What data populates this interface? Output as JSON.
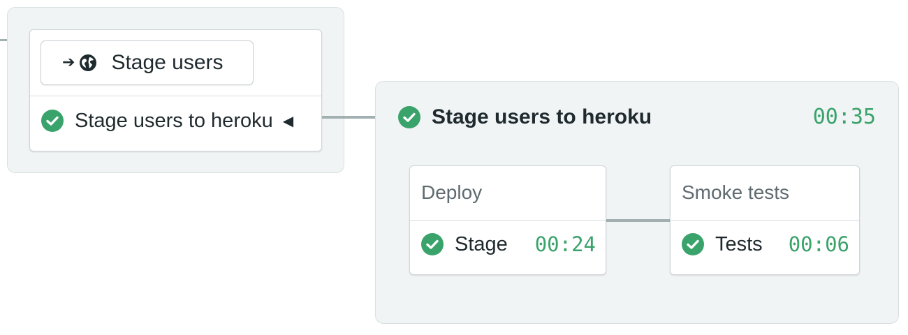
{
  "left_block": {
    "promotion_button": {
      "arrow_icon": "arrow-right-icon",
      "globe_icon": "globe-icon",
      "label": "Stage users"
    },
    "pipeline_link": {
      "status_icon": "check-circle-icon",
      "label": "Stage users to heroku",
      "caret_icon": "caret-left-icon",
      "caret_glyph": "◀"
    }
  },
  "pipeline_panel": {
    "status_icon": "check-circle-icon",
    "title": "Stage users to heroku",
    "duration": "00:35",
    "blocks": [
      {
        "title": "Deploy",
        "job": {
          "status_icon": "check-circle-icon",
          "label": "Stage",
          "duration": "00:24"
        }
      },
      {
        "title": "Smoke tests",
        "job": {
          "status_icon": "check-circle-icon",
          "label": "Tests",
          "duration": "00:06"
        }
      }
    ]
  },
  "colors": {
    "success_green": "#3aa36b",
    "panel_bg": "#f1f4f5",
    "connector": "#a3b0b2",
    "text": "#1f2a2e"
  }
}
